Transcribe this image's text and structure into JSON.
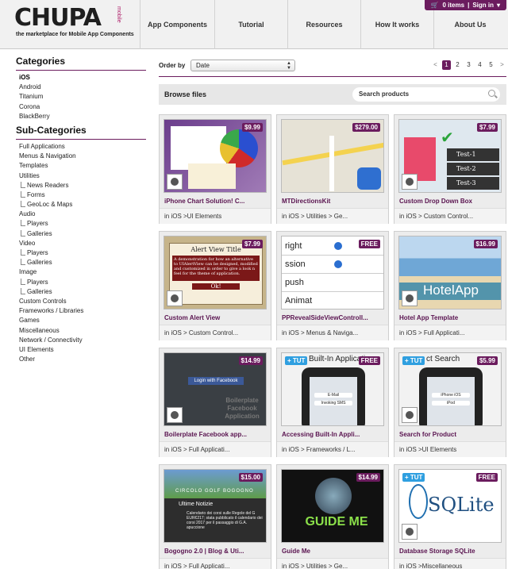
{
  "header": {
    "logo": "CHUPA",
    "logo_badge": "mobile",
    "tagline": "the marketplace for Mobile App Components",
    "nav": [
      "App Components",
      "Tutorial",
      "Resources",
      "How It works",
      "About Us"
    ],
    "cart": "0 items",
    "signin": "Sign in"
  },
  "sidebar": {
    "categories_title": "Categories",
    "categories": [
      "iOS",
      "Android",
      "Titanium",
      "Corona",
      "BlackBerry"
    ],
    "subcategories_title": "Sub-Categories",
    "subcategories": [
      {
        "label": "Full Applications",
        "child": false
      },
      {
        "label": "Menus & Navigation",
        "child": false
      },
      {
        "label": "Templates",
        "child": false
      },
      {
        "label": "Utilities",
        "child": false
      },
      {
        "label": "News Readers",
        "child": true
      },
      {
        "label": "Forms",
        "child": true
      },
      {
        "label": "GeoLoc & Maps",
        "child": true
      },
      {
        "label": "Audio",
        "child": false
      },
      {
        "label": "Players",
        "child": true
      },
      {
        "label": "Galleries",
        "child": true
      },
      {
        "label": "Video",
        "child": false
      },
      {
        "label": "Players",
        "child": true
      },
      {
        "label": "Galleries",
        "child": true
      },
      {
        "label": "Image",
        "child": false
      },
      {
        "label": "Players",
        "child": true
      },
      {
        "label": "Galleries",
        "child": true
      },
      {
        "label": "Custom Controls",
        "child": false
      },
      {
        "label": "Frameworks / Libraries",
        "child": false
      },
      {
        "label": "Games",
        "child": false
      },
      {
        "label": "Miscellaneous",
        "child": false
      },
      {
        "label": "Network / Connectivity",
        "child": false
      },
      {
        "label": "UI Elements",
        "child": false
      },
      {
        "label": "Other",
        "child": false
      }
    ]
  },
  "order": {
    "label": "Order by",
    "value": "Date",
    "pages": [
      "1",
      "2",
      "3",
      "4",
      "5"
    ],
    "prev": "<",
    "next": ">"
  },
  "browse": {
    "title": "Browse files",
    "search_placeholder": "Search products"
  },
  "products": [
    {
      "title": "iPhone Chart Solution! C...",
      "category": "in iOS >UI Elements",
      "price": "$9.99",
      "tut": "",
      "thumb": "chart"
    },
    {
      "title": "MTDirectionsKit",
      "category": "in iOS > Utilities > Ge...",
      "price": "$279.00",
      "tut": "",
      "thumb": "map"
    },
    {
      "title": "Custom Drop Down Box",
      "category": "in iOS > Custom Control...",
      "price": "$7.99",
      "tut": "",
      "thumb": "dropdown"
    },
    {
      "title": "Custom Alert View",
      "category": "in iOS > Custom Control...",
      "price": "$7.99",
      "tut": "",
      "thumb": "alert"
    },
    {
      "title": "PPRevealSideViewControll...",
      "category": "in iOS > Menus & Naviga...",
      "price": "FREE",
      "tut": "",
      "thumb": "reveal"
    },
    {
      "title": "Hotel App Template",
      "category": "in iOS > Full Applicati...",
      "price": "$16.99",
      "tut": "",
      "thumb": "hotel"
    },
    {
      "title": "Boilerplate Facebook app...",
      "category": "in iOS > Full Applicati...",
      "price": "$14.99",
      "tut": "",
      "thumb": "facebook"
    },
    {
      "title": "Accessing Built-In Appli...",
      "category": "in iOS > Frameworks / L...",
      "price": "FREE",
      "tut": "+ TUT",
      "thumb": "builtin"
    },
    {
      "title": "Search for Product",
      "category": "in iOS >UI Elements",
      "price": "$5.99",
      "tut": "+ TUT",
      "thumb": "search"
    },
    {
      "title": "Bogogno 2.0 | Blog & Uti...",
      "category": "in iOS > Full Applicati...",
      "price": "$15.00",
      "tut": "",
      "thumb": "golf"
    },
    {
      "title": "Guide Me",
      "category": "in iOS > Utilities > Ge...",
      "price": "$14.99",
      "tut": "",
      "thumb": "guide"
    },
    {
      "title": "Database Storage SQLite",
      "category": "in iOS >Miscellaneous",
      "price": "FREE",
      "tut": "+ TUT",
      "thumb": "sqlite"
    }
  ],
  "thumb_text": {
    "alert_title": "Alert View Title",
    "alert_body": "A demonstration for how an alternative to UIAlertView can be designed, modified and customized in order to give a look n feel for the theme of application.",
    "alert_ok": "Ok!",
    "reveal_rows": [
      "right",
      "ssion",
      "push",
      "Animat"
    ],
    "hotel_name": "HotelApp",
    "fb_login": "Login with Facebook",
    "fb_text": "Boilerplate Facebook Application",
    "builtin_title": "Built-In Applicati",
    "builtin_buttons": [
      "E-Mail",
      "Invoking SMS"
    ],
    "search_title": "ct Search",
    "search_rows": [
      "iPhone iOS",
      "iPod"
    ],
    "golf_title": "CIRCOLO GOLF BOGOGNO",
    "golf_news": "Ultime Notizie",
    "golf_body": "Calendario dei corsi sulle Regole del G EUR€217; stata pubblicato il calendario dei corsi 2017 per il passaggio di G.A. apuccione",
    "guide_text": "GUIDE ME",
    "sqlite_text": "SQLite",
    "dropdown_items": [
      "Test-1",
      "Test-2",
      "Test-3"
    ]
  }
}
